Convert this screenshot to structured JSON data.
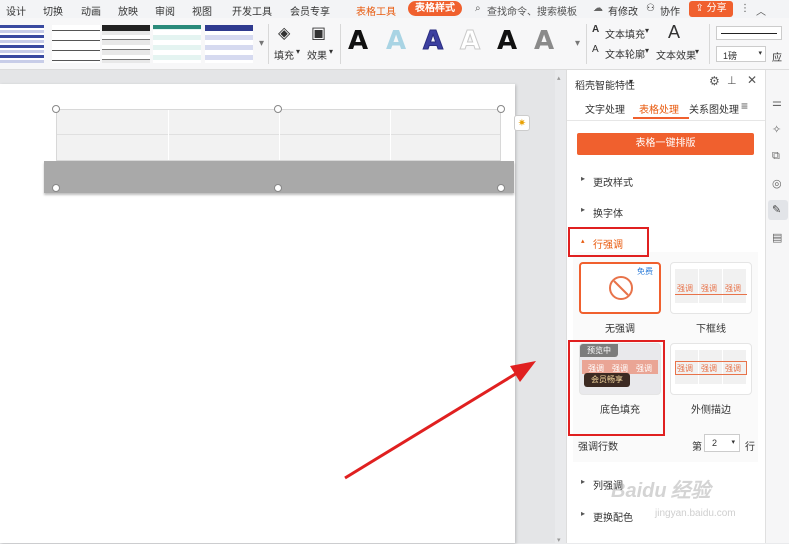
{
  "menubar": {
    "items": [
      "设计",
      "切换",
      "动画",
      "放映",
      "审阅",
      "视图",
      "开发工具",
      "会员专享"
    ],
    "table_tool": "表格工具",
    "table_style": "表格样式",
    "search": "查找命令、搜索模板",
    "has_changes": "有修改",
    "collab": "协作",
    "share": "分享"
  },
  "ribbon": {
    "fill": "填充",
    "effect": "效果",
    "text_fill": "文本填充",
    "text_outline": "文本轮廓",
    "text_effect": "文本效果",
    "line_weight": "1磅",
    "apply": "应"
  },
  "panel": {
    "title": "稻壳智能特性",
    "tabs": [
      "文字处理",
      "表格处理",
      "关系图处理"
    ],
    "menu_icon": "hamburger-icon",
    "one_click_btn": "表格一键排版",
    "sections": {
      "change_style": "更改样式",
      "change_font": "换字体",
      "row_emphasis": "行强调",
      "col_emphasis": "列强调",
      "change_color": "更换配色"
    },
    "cards": {
      "none": {
        "label": "无强调",
        "badge": "免费"
      },
      "underline": {
        "label": "下框线",
        "cell": "强调"
      },
      "fill": {
        "label": "底色填充",
        "preview": "预览中",
        "member": "会员畅享",
        "cell": "强调"
      },
      "outline": {
        "label": "外侧描边",
        "cell": "强调"
      }
    },
    "rows_label": "强调行数",
    "row_prefix": "第",
    "row_value": "2",
    "row_suffix": "行"
  },
  "watermark": {
    "brand": "Baidu",
    "jingyan": "经验",
    "url": "jingyan.baidu.com"
  },
  "colors": {
    "accent": "#f0602e",
    "highlight_box": "#e02020"
  }
}
